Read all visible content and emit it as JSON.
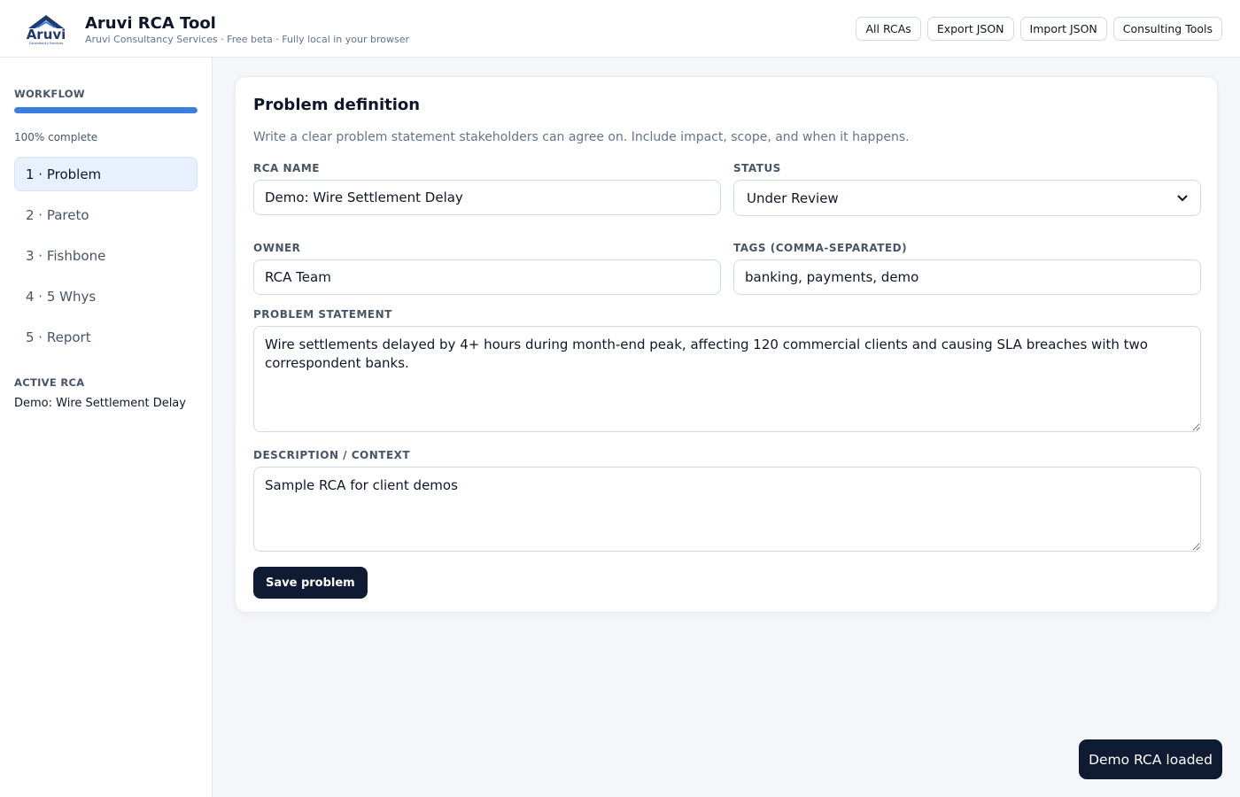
{
  "header": {
    "logo_text": "Aruvi",
    "logo_subtext": "Consultancy Services",
    "title": "Aruvi RCA Tool",
    "subtitle": "Aruvi Consultancy Services · Free beta · Fully local in your browser",
    "actions": [
      "All RCAs",
      "Export JSON",
      "Import JSON",
      "Consulting Tools"
    ]
  },
  "sidebar": {
    "workflow_label": "WORKFLOW",
    "progress_percent": 100,
    "progress_text": "100% complete",
    "steps": [
      {
        "label": "1 · Problem",
        "active": true
      },
      {
        "label": "2 · Pareto",
        "active": false
      },
      {
        "label": "3 · Fishbone",
        "active": false
      },
      {
        "label": "4 · 5 Whys",
        "active": false
      },
      {
        "label": "5 · Report",
        "active": false
      }
    ],
    "active_rca_label": "ACTIVE RCA",
    "active_rca_name": "Demo: Wire Settlement Delay"
  },
  "main": {
    "title": "Problem definition",
    "description": "Write a clear problem statement stakeholders can agree on. Include impact, scope, and when it happens.",
    "rca_name_label": "RCA NAME",
    "rca_name_value": "Demo: Wire Settlement Delay",
    "status_label": "STATUS",
    "status_value": "Under Review",
    "owner_label": "OWNER",
    "owner_value": "RCA Team",
    "tags_label": "TAGS (COMMA-SEPARATED)",
    "tags_value": "banking, payments, demo",
    "problem_statement_label": "PROBLEM STATEMENT",
    "problem_statement_value": "Wire settlements delayed by 4+ hours during month-end peak, affecting 120 commercial clients and causing SLA breaches with two correspondent banks.",
    "description_label": "DESCRIPTION / CONTEXT",
    "description_value": "Sample RCA for client demos",
    "save_label": "Save problem"
  },
  "toast": {
    "message": "Demo RCA loaded"
  },
  "colors": {
    "accent": "#3b7de0",
    "primary_dark": "#0f1b33",
    "active_step_bg": "#e8effd"
  }
}
